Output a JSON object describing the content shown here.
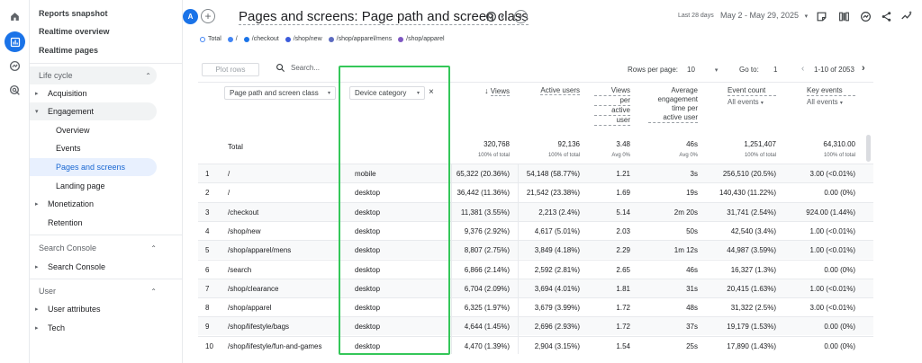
{
  "sidebar": {
    "top_items": [
      "Reports snapshot",
      "Realtime overview",
      "Realtime pages"
    ],
    "lifecycle_label": "Life cycle",
    "acquisition": "Acquisition",
    "engagement": "Engagement",
    "engagement_children": [
      "Overview",
      "Events",
      "Pages and screens",
      "Landing page"
    ],
    "monetization": "Monetization",
    "retention": "Retention",
    "search_console_label": "Search Console",
    "search_console_item": "Search Console",
    "user_label": "User",
    "user_attributes": "User attributes",
    "tech": "Tech"
  },
  "header": {
    "avatar": "A",
    "title": "Pages and screens: Page path and screen class",
    "date_label": "Last 28 days",
    "date_range": "May 2 - May 29, 2025"
  },
  "legend": [
    "Total",
    "/",
    "/checkout",
    "/shop/new",
    "/shop/apparel/mens",
    "/shop/apparel"
  ],
  "legend_colors": [
    "#ffffff",
    "#4285f4",
    "#1a73e8",
    "#3b5bdb",
    "#5c6bc0",
    "#7e57c2"
  ],
  "toolbar": {
    "plot_rows": "Plot rows",
    "search_placeholder": "Search...",
    "rows_per_page_label": "Rows per page:",
    "rows_per_page": "10",
    "goto_label": "Go to:",
    "goto_value": "1",
    "range": "1-10 of 2053"
  },
  "columns": {
    "dim1": "Page path and screen class",
    "dim2": "Device category",
    "views": "Views",
    "active_users": "Active users",
    "views_per_user": [
      "Views",
      "per",
      "active",
      "user"
    ],
    "avg_time": [
      "Average",
      "engagement",
      "time per",
      "active user"
    ],
    "event_count": "Event count",
    "event_count_sub": "All events",
    "key_events": "Key events",
    "key_events_sub": "All events"
  },
  "total": {
    "label": "Total",
    "views": "320,768",
    "views_sub": "100% of total",
    "active_users": "92,136",
    "active_users_sub": "100% of total",
    "vpu": "3.48",
    "vpu_sub": "Avg 0%",
    "avg_time": "46s",
    "avg_time_sub": "Avg 0%",
    "events": "1,251,407",
    "events_sub": "100% of total",
    "key": "64,310.00",
    "key_sub": "100% of total"
  },
  "rows": [
    {
      "n": "1",
      "path": "/",
      "device": "mobile",
      "views": "65,322 (20.36%)",
      "users": "54,148 (58.77%)",
      "vpu": "1.21",
      "time": "3s",
      "events": "256,510 (20.5%)",
      "key": "3.00 (<0.01%)"
    },
    {
      "n": "2",
      "path": "/",
      "device": "desktop",
      "views": "36,442 (11.36%)",
      "users": "21,542 (23.38%)",
      "vpu": "1.69",
      "time": "19s",
      "events": "140,430 (11.22%)",
      "key": "0.00 (0%)"
    },
    {
      "n": "3",
      "path": "/checkout",
      "device": "desktop",
      "views": "11,381 (3.55%)",
      "users": "2,213 (2.4%)",
      "vpu": "5.14",
      "time": "2m 20s",
      "events": "31,741 (2.54%)",
      "key": "924.00 (1.44%)"
    },
    {
      "n": "4",
      "path": "/shop/new",
      "device": "desktop",
      "views": "9,376 (2.92%)",
      "users": "4,617 (5.01%)",
      "vpu": "2.03",
      "time": "50s",
      "events": "42,540 (3.4%)",
      "key": "1.00 (<0.01%)"
    },
    {
      "n": "5",
      "path": "/shop/apparel/mens",
      "device": "desktop",
      "views": "8,807 (2.75%)",
      "users": "3,849 (4.18%)",
      "vpu": "2.29",
      "time": "1m 12s",
      "events": "44,987 (3.59%)",
      "key": "1.00 (<0.01%)"
    },
    {
      "n": "6",
      "path": "/search",
      "device": "desktop",
      "views": "6,866 (2.14%)",
      "users": "2,592 (2.81%)",
      "vpu": "2.65",
      "time": "46s",
      "events": "16,327 (1.3%)",
      "key": "0.00 (0%)"
    },
    {
      "n": "7",
      "path": "/shop/clearance",
      "device": "desktop",
      "views": "6,704 (2.09%)",
      "users": "3,694 (4.01%)",
      "vpu": "1.81",
      "time": "31s",
      "events": "20,415 (1.63%)",
      "key": "1.00 (<0.01%)"
    },
    {
      "n": "8",
      "path": "/shop/apparel",
      "device": "desktop",
      "views": "6,325 (1.97%)",
      "users": "3,679 (3.99%)",
      "vpu": "1.72",
      "time": "48s",
      "events": "31,322 (2.5%)",
      "key": "3.00 (<0.01%)"
    },
    {
      "n": "9",
      "path": "/shop/lifestyle/bags",
      "device": "desktop",
      "views": "4,644 (1.45%)",
      "users": "2,696 (2.93%)",
      "vpu": "1.72",
      "time": "37s",
      "events": "19,179 (1.53%)",
      "key": "0.00 (0%)"
    },
    {
      "n": "10",
      "path": "/shop/lifestyle/fun-and-games",
      "device": "desktop",
      "views": "4,470 (1.39%)",
      "users": "2,904 (3.15%)",
      "vpu": "1.54",
      "time": "25s",
      "events": "17,890 (1.43%)",
      "key": "0.00 (0%)"
    }
  ]
}
